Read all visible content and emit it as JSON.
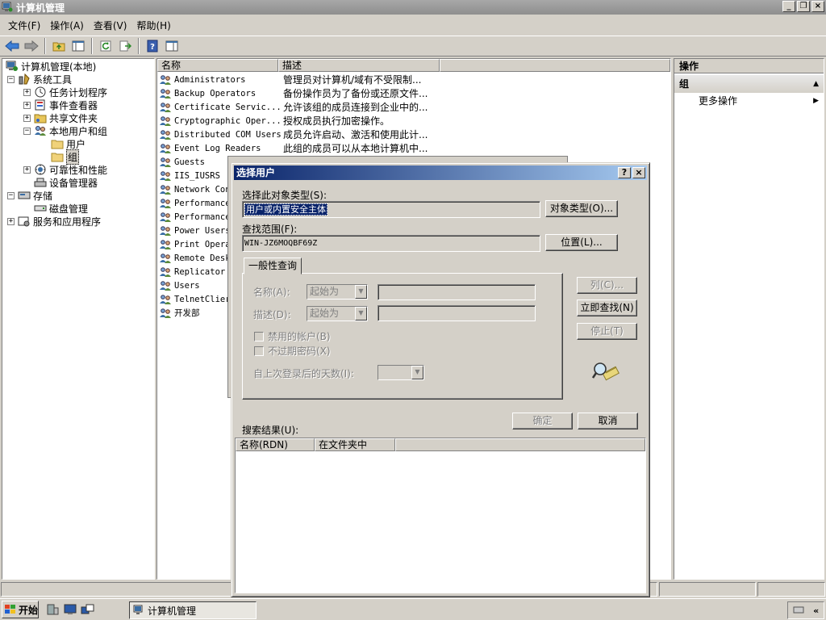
{
  "window": {
    "title": "计算机管理",
    "buttons": [
      "_",
      "🗗",
      "×"
    ]
  },
  "menu": [
    "文件(F)",
    "操作(A)",
    "查看(V)",
    "帮助(H)"
  ],
  "tree": [
    {
      "label": "计算机管理(本地)",
      "icon": "computer-icon",
      "exp": "",
      "level": 0
    },
    {
      "label": "系统工具",
      "icon": "tools-icon",
      "exp": "−",
      "level": 1
    },
    {
      "label": "任务计划程序",
      "icon": "clock-icon",
      "exp": "+",
      "level": 2
    },
    {
      "label": "事件查看器",
      "icon": "event-viewer-icon",
      "exp": "+",
      "level": 2
    },
    {
      "label": "共享文件夹",
      "icon": "shared-folder-icon",
      "exp": "+",
      "level": 2
    },
    {
      "label": "本地用户和组",
      "icon": "users-icon",
      "exp": "−",
      "level": 2
    },
    {
      "label": "用户",
      "icon": "folder-icon",
      "exp": "",
      "level": 3
    },
    {
      "label": "组",
      "icon": "folder-icon",
      "exp": "",
      "level": 3,
      "selected": true
    },
    {
      "label": "可靠性和性能",
      "icon": "performance-icon",
      "exp": "+",
      "level": 2
    },
    {
      "label": "设备管理器",
      "icon": "device-manager-icon",
      "exp": "",
      "level": 2
    },
    {
      "label": "存储",
      "icon": "storage-icon",
      "exp": "−",
      "level": 1
    },
    {
      "label": "磁盘管理",
      "icon": "disk-icon",
      "exp": "",
      "level": 2
    },
    {
      "label": "服务和应用程序",
      "icon": "services-icon",
      "exp": "+",
      "level": 1
    }
  ],
  "list": {
    "columns": [
      "名称",
      "描述"
    ],
    "rows": [
      {
        "name": "Administrators",
        "desc": "管理员对计算机/域有不受限制..."
      },
      {
        "name": "Backup Operators",
        "desc": "备份操作员为了备份或还原文件..."
      },
      {
        "name": "Certificate Servic...",
        "desc": "允许该组的成员连接到企业中的..."
      },
      {
        "name": "Cryptographic Oper...",
        "desc": "授权成员执行加密操作。"
      },
      {
        "name": "Distributed COM Users",
        "desc": "成员允许启动、激活和使用此计..."
      },
      {
        "name": "Event Log Readers",
        "desc": "此组的成员可以从本地计算机中..."
      },
      {
        "name": "Guests",
        "desc": ""
      },
      {
        "name": "IIS_IUSRS",
        "desc": ""
      },
      {
        "name": "Network Con",
        "desc": ""
      },
      {
        "name": "Performance",
        "desc": ""
      },
      {
        "name": "Performance",
        "desc": ""
      },
      {
        "name": "Power Users",
        "desc": ""
      },
      {
        "name": "Print Opera",
        "desc": ""
      },
      {
        "name": "Remote Desk",
        "desc": ""
      },
      {
        "name": "Replicator",
        "desc": ""
      },
      {
        "name": "Users",
        "desc": ""
      },
      {
        "name": "TelnetClier",
        "desc": ""
      },
      {
        "name": "开发部",
        "desc": ""
      }
    ]
  },
  "actions": {
    "header": "操作",
    "section": "组",
    "more": "更多操作"
  },
  "dialog": {
    "title": "选择用户",
    "help_btn": "?",
    "close_btn": "×",
    "object_type_label": "选择此对象类型(S):",
    "object_type_value": "用户或内置安全主体",
    "object_type_btn": "对象类型(O)...",
    "location_label": "查找范围(F):",
    "location_value": "WIN-JZ6MOQBF69Z",
    "location_btn": "位置(L)...",
    "tab_label": "一般性查询",
    "name_label": "名称(A):",
    "name_combo": "起始为",
    "desc_label": "描述(D):",
    "desc_combo": "起始为",
    "disabled_accounts": "禁用的帐户(B)",
    "non_expiring": "不过期密码(X)",
    "days_label": "自上次登录后的天数(I):",
    "columns_btn": "列(C)...",
    "find_now_btn": "立即查找(N)",
    "stop_btn": "停止(T)",
    "ok_btn": "确定",
    "cancel_btn": "取消",
    "results_label": "搜索结果(U):",
    "results_columns": [
      "名称(RDN)",
      "在文件夹中"
    ]
  },
  "taskbar": {
    "start": "开始",
    "task": "计算机管理"
  }
}
